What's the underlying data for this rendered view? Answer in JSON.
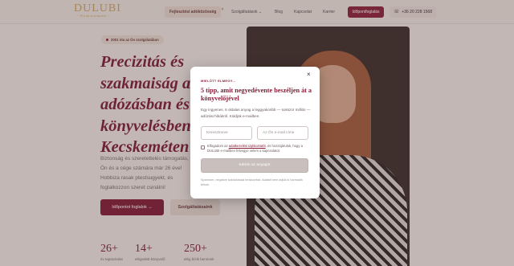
{
  "nav": {
    "logo_text": "DULUBI",
    "logo_sub": "~ Pro ad is konyvelo ~",
    "highlight_pill": "Fejlesztési adóközösség",
    "highlight_close": "×",
    "links": [
      "Szolgáltatások",
      "Blog",
      "Kapcsolat",
      "Karrier"
    ],
    "dropdown_caret": "⌄",
    "cta": "Időpontfoglalás",
    "phone": "+36 20 228 1568",
    "phone_icon": "☏"
  },
  "hero": {
    "badge": "2001 óta az Ön szolgálatában",
    "title": "Precizitás és szakmaiság az adózásban és könyvelésben, Kecskeméten",
    "description": "Biztonság és szeretettelés támogatás, az Ön és a cége számára már 26 éve! Hobbiza rasak ptestsugyekt, és foglalkozzon szeret csinálni!",
    "btn_primary": "Időpontot foglalok",
    "btn_primary_arrow": "→",
    "btn_secondary": "Szolgáltatásaink"
  },
  "stats": [
    {
      "number": "26+",
      "label": "év tapasztalat"
    },
    {
      "number": "14+",
      "label": "elégedett könyvelő"
    },
    {
      "number": "250+",
      "label": "elég bízik bennünk"
    }
  ],
  "modal": {
    "close": "×",
    "kicker": "MIELŐTT ELMEGY...",
    "title": "5 tipp, amit negyedévente beszéljen át a könyvelőjével",
    "text": "Egy ingyenes, 6 oldalas anyag a leggyakoribb — sokszor milliós — adózási hibákról. Küldjük e-mailben.",
    "first_name_placeholder": "Keresztneve",
    "email_placeholder": "Az Ön e-mail címe",
    "consent_before": "Elfogadom az ",
    "consent_link": "adatkezelési tájékoztatót",
    "consent_after": ", és hozzájárulok, hogy a DULUBI e-mailben felvegye velem a kapcsolatot.",
    "submit": "Kérem az anyagot",
    "footer": "Spammer, negatíve tudósítással terakozthat. Adatait nem adjuk ki harmadik félnek."
  },
  "colors": {
    "accent": "#8a1e38",
    "gold": "#c9a265",
    "background": "#efe7e2"
  }
}
